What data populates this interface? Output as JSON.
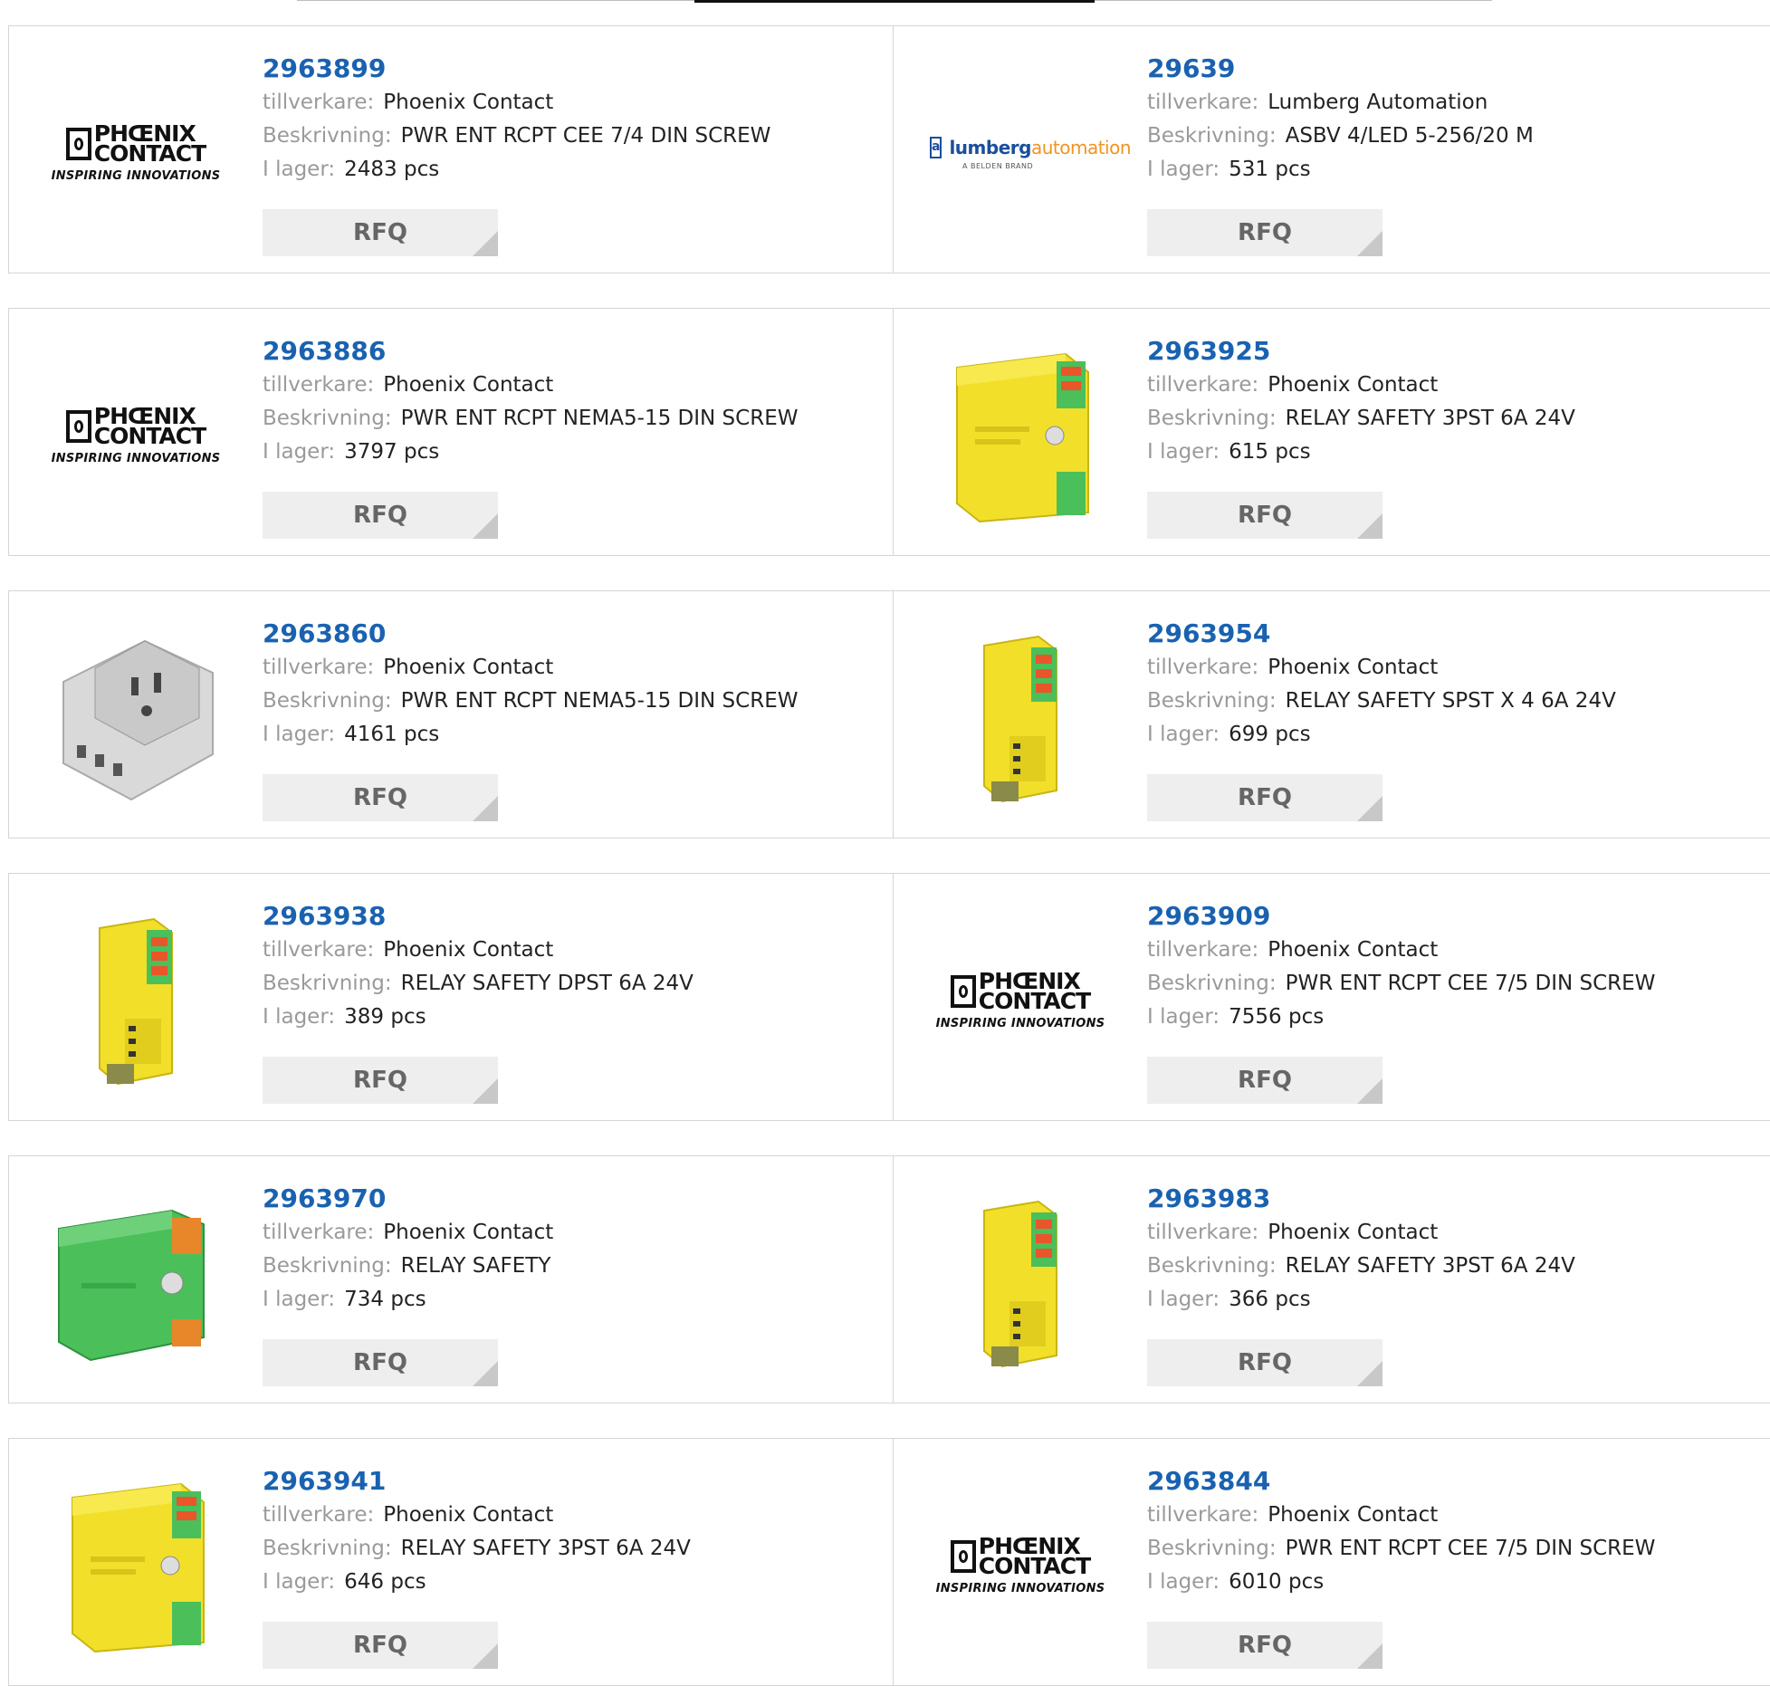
{
  "labels": {
    "manufacturer": "tillverkare:",
    "description": "Beskrivning:",
    "stock": "I lager:",
    "rfq": "RFQ"
  },
  "logos": {
    "phoenix": {
      "line1": "PHŒNIX",
      "line2": "CONTACT",
      "tagline": "INSPIRING INNOVATIONS"
    },
    "lumberg": {
      "icon": "a",
      "name": "lumberg",
      "name2": "automation",
      "sub": "A BELDEN BRAND"
    }
  },
  "colors": {
    "link": "#1a62b0",
    "label": "#9a9a9a",
    "rfq_bg": "#eeeeee",
    "safety_yellow": "#f2df2a",
    "safety_green": "#4bbf5a"
  },
  "products": [
    {
      "part": "2963899",
      "manufacturer": "Phoenix Contact",
      "description": "PWR ENT RCPT CEE 7/4 DIN SCREW",
      "stock": "2483 pcs",
      "image": "phoenix-logo"
    },
    {
      "part": "29639",
      "manufacturer": "Lumberg Automation",
      "description": "ASBV 4/LED 5-256/20 M",
      "stock": "531 pcs",
      "image": "lumberg-logo"
    },
    {
      "part": "2963886",
      "manufacturer": "Phoenix Contact",
      "description": "PWR ENT RCPT NEMA5-15 DIN SCREW",
      "stock": "3797 pcs",
      "image": "phoenix-logo"
    },
    {
      "part": "2963925",
      "manufacturer": "Phoenix Contact",
      "description": "RELAY SAFETY 3PST 6A 24V",
      "stock": "615 pcs",
      "image": "yellow-relay-wide"
    },
    {
      "part": "2963860",
      "manufacturer": "Phoenix Contact",
      "description": "PWR ENT RCPT NEMA5-15 DIN SCREW",
      "stock": "4161 pcs",
      "image": "gray-receptacle"
    },
    {
      "part": "2963954",
      "manufacturer": "Phoenix Contact",
      "description": "RELAY SAFETY SPST X 4 6A 24V",
      "stock": "699 pcs",
      "image": "yellow-relay-narrow"
    },
    {
      "part": "2963938",
      "manufacturer": "Phoenix Contact",
      "description": "RELAY SAFETY DPST 6A 24V",
      "stock": "389 pcs",
      "image": "yellow-relay-narrow"
    },
    {
      "part": "2963909",
      "manufacturer": "Phoenix Contact",
      "description": "PWR ENT RCPT CEE 7/5 DIN SCREW",
      "stock": "7556 pcs",
      "image": "phoenix-logo"
    },
    {
      "part": "2963970",
      "manufacturer": "Phoenix Contact",
      "description": "RELAY SAFETY",
      "stock": "734 pcs",
      "image": "green-relay"
    },
    {
      "part": "2963983",
      "manufacturer": "Phoenix Contact",
      "description": "RELAY SAFETY 3PST 6A 24V",
      "stock": "366 pcs",
      "image": "yellow-relay-narrow"
    },
    {
      "part": "2963941",
      "manufacturer": "Phoenix Contact",
      "description": "RELAY SAFETY 3PST 6A 24V",
      "stock": "646 pcs",
      "image": "yellow-relay-wide"
    },
    {
      "part": "2963844",
      "manufacturer": "Phoenix Contact",
      "description": "PWR ENT RCPT CEE 7/5 DIN SCREW",
      "stock": "6010 pcs",
      "image": "phoenix-logo"
    }
  ]
}
